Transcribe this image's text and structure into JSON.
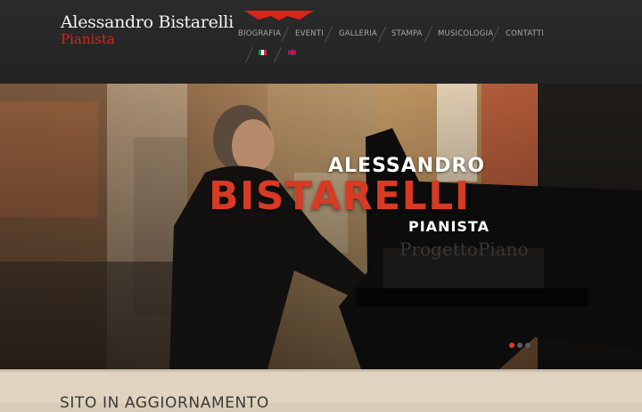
{
  "brand": {
    "name": "Alessandro Bistarelli",
    "subtitle": "Pianista"
  },
  "nav": {
    "items": [
      {
        "label": "BIOGRAFIA"
      },
      {
        "label": "EVENTI"
      },
      {
        "label": "GALLERIA"
      },
      {
        "label": "STAMPA"
      },
      {
        "label": "MUSICOLOGIA"
      },
      {
        "label": "CONTATTI"
      }
    ],
    "languages": [
      "it-flag-icon",
      "uk-flag-icon"
    ]
  },
  "hero": {
    "line1": "ALESSANDRO",
    "line2": "BISTARELLI",
    "line3": "PIANISTA",
    "piano_brand": "ProgettoPiano",
    "slides": 3,
    "active_slide": 1
  },
  "content": {
    "heading": "SITO IN AGGIORNAMENTO"
  },
  "colors": {
    "header": "#2b2b2b",
    "accent": "#d83a24",
    "background": "#d9cdb9"
  }
}
